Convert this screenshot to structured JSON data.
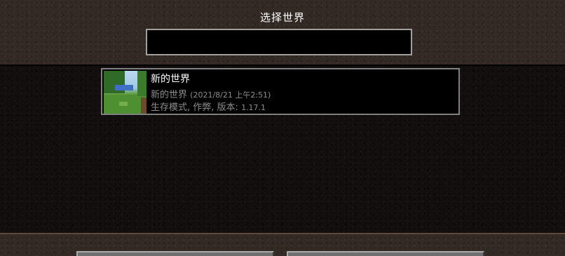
{
  "screen": {
    "title": "选择世界"
  },
  "search": {
    "value": ""
  },
  "worlds": [
    {
      "name": "新的世界",
      "folder": "新的世界",
      "date": "(2021/8/21 上午2:51)",
      "mode": "生存模式, 作弊, 版本:",
      "version": "1.17.1"
    }
  ]
}
